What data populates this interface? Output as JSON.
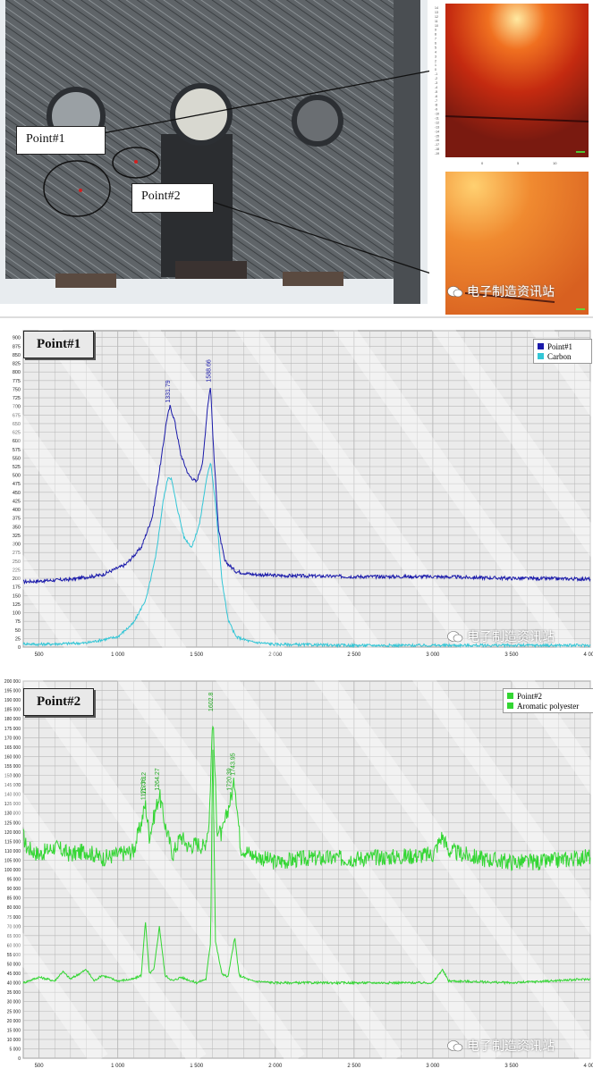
{
  "photo": {
    "point1_label": "Point#1",
    "point2_label": "Point#2",
    "watermark": "电子制造资讯站",
    "inset_x_ticks": [
      "0",
      "5",
      "10"
    ],
    "inset_y_ticks": [
      "14",
      "13",
      "12",
      "11",
      "10",
      "9",
      "8",
      "7",
      "6",
      "5",
      "4",
      "3",
      "2",
      "1",
      "0",
      "-1",
      "-2",
      "-3",
      "-4",
      "-5",
      "-6",
      "-7",
      "-8",
      "-9",
      "-10",
      "-11",
      "-12",
      "-13",
      "-14",
      "-15",
      "-16",
      "-17",
      "-18",
      "-19"
    ]
  },
  "colors": {
    "point1": "#1a1aaa",
    "carbon": "#33c6d6",
    "point2": "#33d633",
    "aromatic": "#33d633",
    "grid": "#b8b8b8",
    "plot_bg": "#ebebeb"
  },
  "chart_data": [
    {
      "type": "line",
      "title": "Point#1",
      "x_ticks": [
        1000,
        1500,
        2000,
        2500,
        3000,
        3500,
        4000
      ],
      "x_tick_labels": [
        "1 000",
        "1 500",
        "2 000",
        "2 500",
        "3 000",
        "3 500",
        "4 000"
      ],
      "x_first_label": "500",
      "xlim": [
        400,
        4000
      ],
      "y_ticks": [
        0,
        25,
        50,
        75,
        100,
        125,
        150,
        175,
        200,
        225,
        250,
        275,
        300,
        325,
        350,
        375,
        400,
        425,
        450,
        475,
        500,
        525,
        550,
        575,
        600,
        625,
        650,
        675,
        700,
        725,
        750,
        775,
        800,
        825,
        850,
        875,
        900
      ],
      "ylim": [
        0,
        920
      ],
      "legend": "top-right",
      "grid": true,
      "series": [
        {
          "name": "Point#1",
          "x": [
            400,
            500,
            700,
            900,
            1050,
            1150,
            1220,
            1280,
            1310,
            1332,
            1360,
            1400,
            1450,
            1500,
            1540,
            1570,
            1589,
            1610,
            1640,
            1680,
            1750,
            1850,
            2000,
            2500,
            3000,
            3500,
            4000
          ],
          "y": [
            190,
            192,
            197,
            210,
            240,
            290,
            380,
            560,
            660,
            700,
            660,
            560,
            500,
            480,
            540,
            700,
            760,
            560,
            340,
            250,
            220,
            212,
            208,
            205,
            205,
            200,
            198
          ]
        },
        {
          "name": "Carbon",
          "x": [
            400,
            500,
            800,
            1000,
            1100,
            1180,
            1240,
            1290,
            1320,
            1340,
            1370,
            1420,
            1470,
            1520,
            1560,
            1590,
            1620,
            1660,
            1700,
            1750,
            1850,
            2000,
            2500,
            3000,
            3500,
            4000
          ],
          "y": [
            10,
            8,
            12,
            30,
            70,
            140,
            260,
            430,
            495,
            490,
            420,
            320,
            290,
            360,
            480,
            540,
            420,
            200,
            80,
            30,
            15,
            8,
            5,
            5,
            5,
            5
          ]
        }
      ],
      "peak_labels": [
        {
          "x": 1331.79,
          "y": 700,
          "text": "1331.79"
        },
        {
          "x": 1588.66,
          "y": 760,
          "text": "1588.66"
        }
      ]
    },
    {
      "type": "line",
      "title": "Point#2",
      "x_ticks": [
        500,
        1000,
        1500,
        2000,
        2500,
        3000,
        3500,
        4000
      ],
      "x_tick_labels": [
        "500",
        "1 000",
        "1 500",
        "2 000",
        "2 500",
        "3 000",
        "3 500",
        "4 000"
      ],
      "xlim": [
        400,
        4000
      ],
      "y_ticks": [
        0,
        5000,
        10000,
        15000,
        20000,
        25000,
        30000,
        35000,
        40000,
        45000,
        50000,
        55000,
        60000,
        65000,
        70000,
        75000,
        80000,
        85000,
        90000,
        95000,
        100000,
        105000,
        110000,
        115000,
        120000,
        125000,
        130000,
        135000,
        140000,
        145000,
        150000,
        155000,
        160000,
        165000,
        170000,
        175000,
        180000,
        185000,
        190000,
        195000,
        200000
      ],
      "y_tick_labels": [
        "0",
        "5 000",
        "10 000",
        "15 000",
        "20 000",
        "25 000",
        "30 000",
        "35 000",
        "40 000",
        "45 000",
        "50 000",
        "55 000",
        "60 000",
        "65 000",
        "70 000",
        "75 000",
        "80 000",
        "85 000",
        "90 000",
        "95 000",
        "100 000",
        "105 000",
        "110 000",
        "115 000",
        "120 000",
        "125 000",
        "130 000",
        "135 000",
        "140 000",
        "145 000",
        "150 000",
        "155 000",
        "160 000",
        "165 000",
        "170 000",
        "175 000",
        "180 000",
        "185 000",
        "190 000",
        "195 000",
        "200 000"
      ],
      "ylim": [
        0,
        200000
      ],
      "legend": "top-right",
      "grid": true,
      "series": [
        {
          "name": "Point#2",
          "x": [
            400,
            420,
            500,
            600,
            700,
            800,
            900,
            1000,
            1100,
            1150,
            1175,
            1200,
            1230,
            1264,
            1300,
            1350,
            1400,
            1450,
            1500,
            1550,
            1580,
            1603,
            1630,
            1660,
            1700,
            1743,
            1780,
            1850,
            2000,
            2200,
            2500,
            2800,
            3000,
            3060,
            3100,
            3300,
            3500,
            3700,
            4000
          ],
          "y": [
            118000,
            112000,
            108000,
            112000,
            108000,
            110000,
            106000,
            108000,
            110000,
            125000,
            135000,
            118000,
            128000,
            140000,
            124000,
            108000,
            118000,
            112000,
            114000,
            112000,
            125000,
            182000,
            122000,
            118000,
            132000,
            147000,
            112000,
            108000,
            104000,
            106000,
            106000,
            107000,
            108000,
            118000,
            110000,
            106000,
            104000,
            104000,
            107000
          ]
        },
        {
          "name": "Aromatic polyester",
          "x": [
            400,
            500,
            600,
            650,
            700,
            800,
            850,
            900,
            1000,
            1100,
            1150,
            1175,
            1200,
            1230,
            1264,
            1300,
            1350,
            1400,
            1500,
            1560,
            1590,
            1603,
            1620,
            1660,
            1700,
            1730,
            1743,
            1770,
            1850,
            2000,
            2500,
            3000,
            3060,
            3100,
            3500,
            4000
          ],
          "y": [
            40000,
            43000,
            41000,
            46000,
            42000,
            47000,
            41000,
            44000,
            41000,
            42000,
            44000,
            73000,
            45000,
            47000,
            70000,
            44000,
            41000,
            43000,
            40000,
            42000,
            62000,
            170000,
            62000,
            45000,
            43000,
            58000,
            64000,
            44000,
            41000,
            40000,
            40000,
            40000,
            47000,
            41000,
            40000,
            42000
          ]
        }
      ],
      "peak_labels": [
        {
          "x": 1175,
          "y": 135000,
          "text": "1175.36"
        },
        {
          "x": 1177.12,
          "y": 138000,
          "text": "1177.12"
        },
        {
          "x": 1264.27,
          "y": 140000,
          "text": "1264.27"
        },
        {
          "x": 1602.8,
          "y": 182000,
          "text": "1602.8"
        },
        {
          "x": 1720.39,
          "y": 140000,
          "text": "1720.39"
        },
        {
          "x": 1743.95,
          "y": 148000,
          "text": "1743.95"
        }
      ]
    }
  ],
  "watermarks": {
    "chart1": "电子制造资讯站",
    "chart2": "电子制造资讯站"
  }
}
